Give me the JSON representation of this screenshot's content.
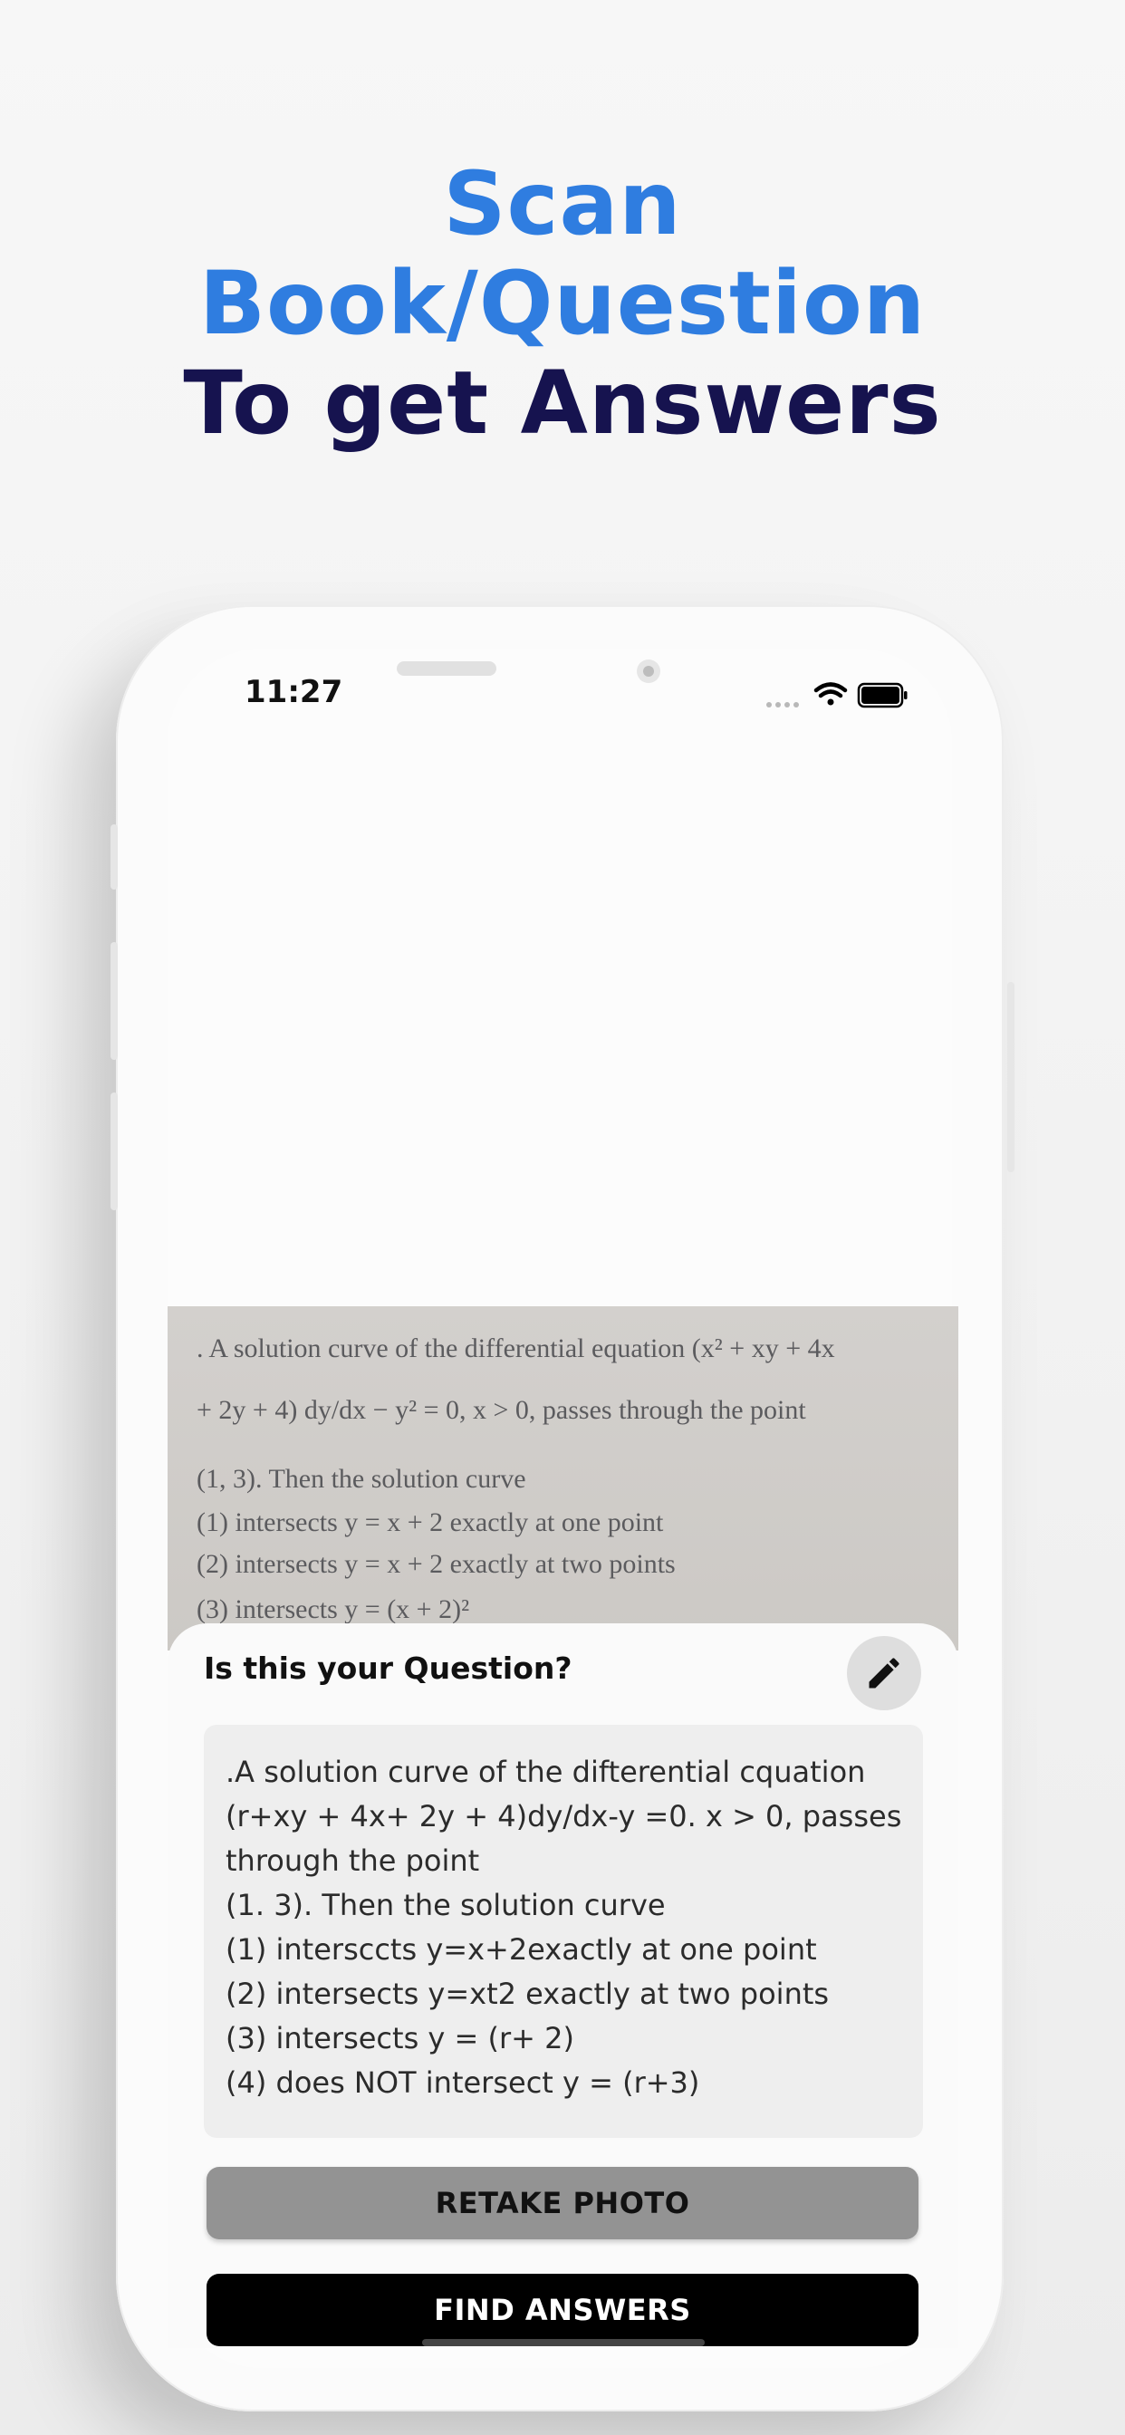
{
  "promo": {
    "line1": "Scan",
    "line2": "Book/Question",
    "line3": "To get Answers"
  },
  "status_bar": {
    "time": "11:27",
    "icons": [
      "signal-icon",
      "wifi-icon",
      "battery-icon"
    ]
  },
  "photo": {
    "lines": [
      ". A solution curve of the differential equation (x² + xy + 4x",
      "+ 2y + 4) dy/dx − y² = 0, x > 0, passes through the point",
      "(1, 3). Then the solution curve",
      "(1)  intersects y = x + 2 exactly at one point",
      "(2)  intersects y = x + 2 exactly at two points",
      "(3)  intersects y = (x + 2)²"
    ]
  },
  "sheet": {
    "title": "Is this your Question?",
    "edit_icon": "pencil-icon",
    "question_lines": [
      ".A solution curve of the difterential cquation",
      "(r+xy + 4x+ 2y + 4)dy/dx-y =0. x > 0, passes",
      "through the point",
      "(1. 3). Then the solution curve",
      "(1) intersccts y=x+2exactly at one point",
      "(2) intersects y=xt2 exactly at two points",
      "(3) intersects y = (r+ 2)",
      "(4) does NOT intersect y = (r+3)"
    ],
    "retake_label": "RETAKE PHOTO",
    "find_label": "FIND ANSWERS"
  },
  "colors": {
    "accent_blue": "#2f7de0",
    "navy": "#16134f",
    "retake_bg": "#939393",
    "find_bg": "#000000"
  }
}
